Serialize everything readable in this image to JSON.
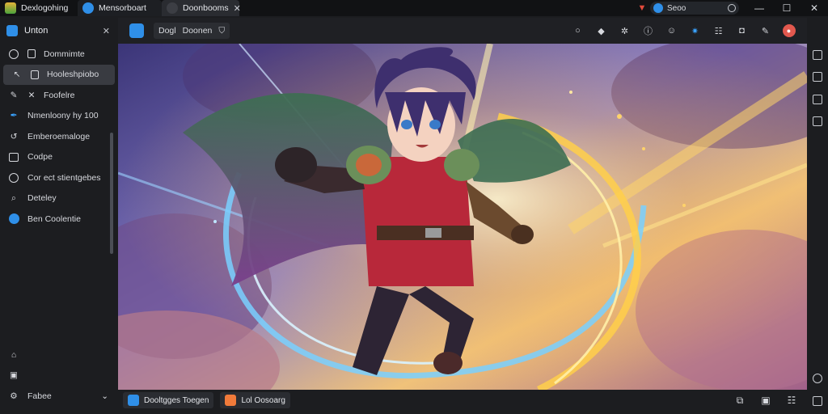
{
  "titlebar": {
    "app_label": "Dexlogohing",
    "tabs": [
      {
        "label": "Mensorboart"
      },
      {
        "label": "Doonbooms",
        "close": "✕"
      }
    ],
    "address": "Seoo",
    "window_controls": {
      "minimize": "—",
      "maximize": "☐",
      "close": "✕"
    }
  },
  "sidebar": {
    "header": "Unton",
    "close": "✕",
    "items": [
      {
        "label": "Dommimte",
        "icon": "ring-icon"
      },
      {
        "label": "Hooleshpiobo",
        "icon": "back-arrow-icon",
        "active": true
      },
      {
        "label": "Foofelre",
        "icon": "pencil-icon"
      },
      {
        "label": "Nmenloony hy 100",
        "icon": "pen-icon"
      },
      {
        "label": "Emberoemaloge",
        "icon": "leaf-icon"
      },
      {
        "label": "Codpe",
        "icon": "layers-icon"
      },
      {
        "label": "Cor ect stientgebes",
        "icon": "ring-icon"
      },
      {
        "label": "Deteley",
        "icon": "search-icon"
      },
      {
        "label": "Ben Coolentie",
        "icon": "blue-ball-icon"
      }
    ],
    "bottom_items": [
      {
        "label": "",
        "icon": "home-icon"
      },
      {
        "label": "",
        "icon": "box-icon"
      },
      {
        "label": "Fabee",
        "icon": "gear-icon",
        "chevron": "⌄"
      }
    ]
  },
  "toolbar": {
    "button_a": "Dogl",
    "button_b": "Doonen",
    "icons": [
      "circle-icon",
      "pin-icon",
      "shuffle-icon",
      "info-icon",
      "smile-icon",
      "gear-blue-icon",
      "grid-icon",
      "chat-icon",
      "edit-icon",
      "alert-icon"
    ]
  },
  "bottombar": {
    "chip_a": "Dooltgges Toegen",
    "chip_b": "Lol Oosoarg"
  },
  "colors": {
    "accent": "#2f8fe8",
    "danger": "#e2584e",
    "chrome_dark": "#111214",
    "panel": "#1c1d20"
  }
}
